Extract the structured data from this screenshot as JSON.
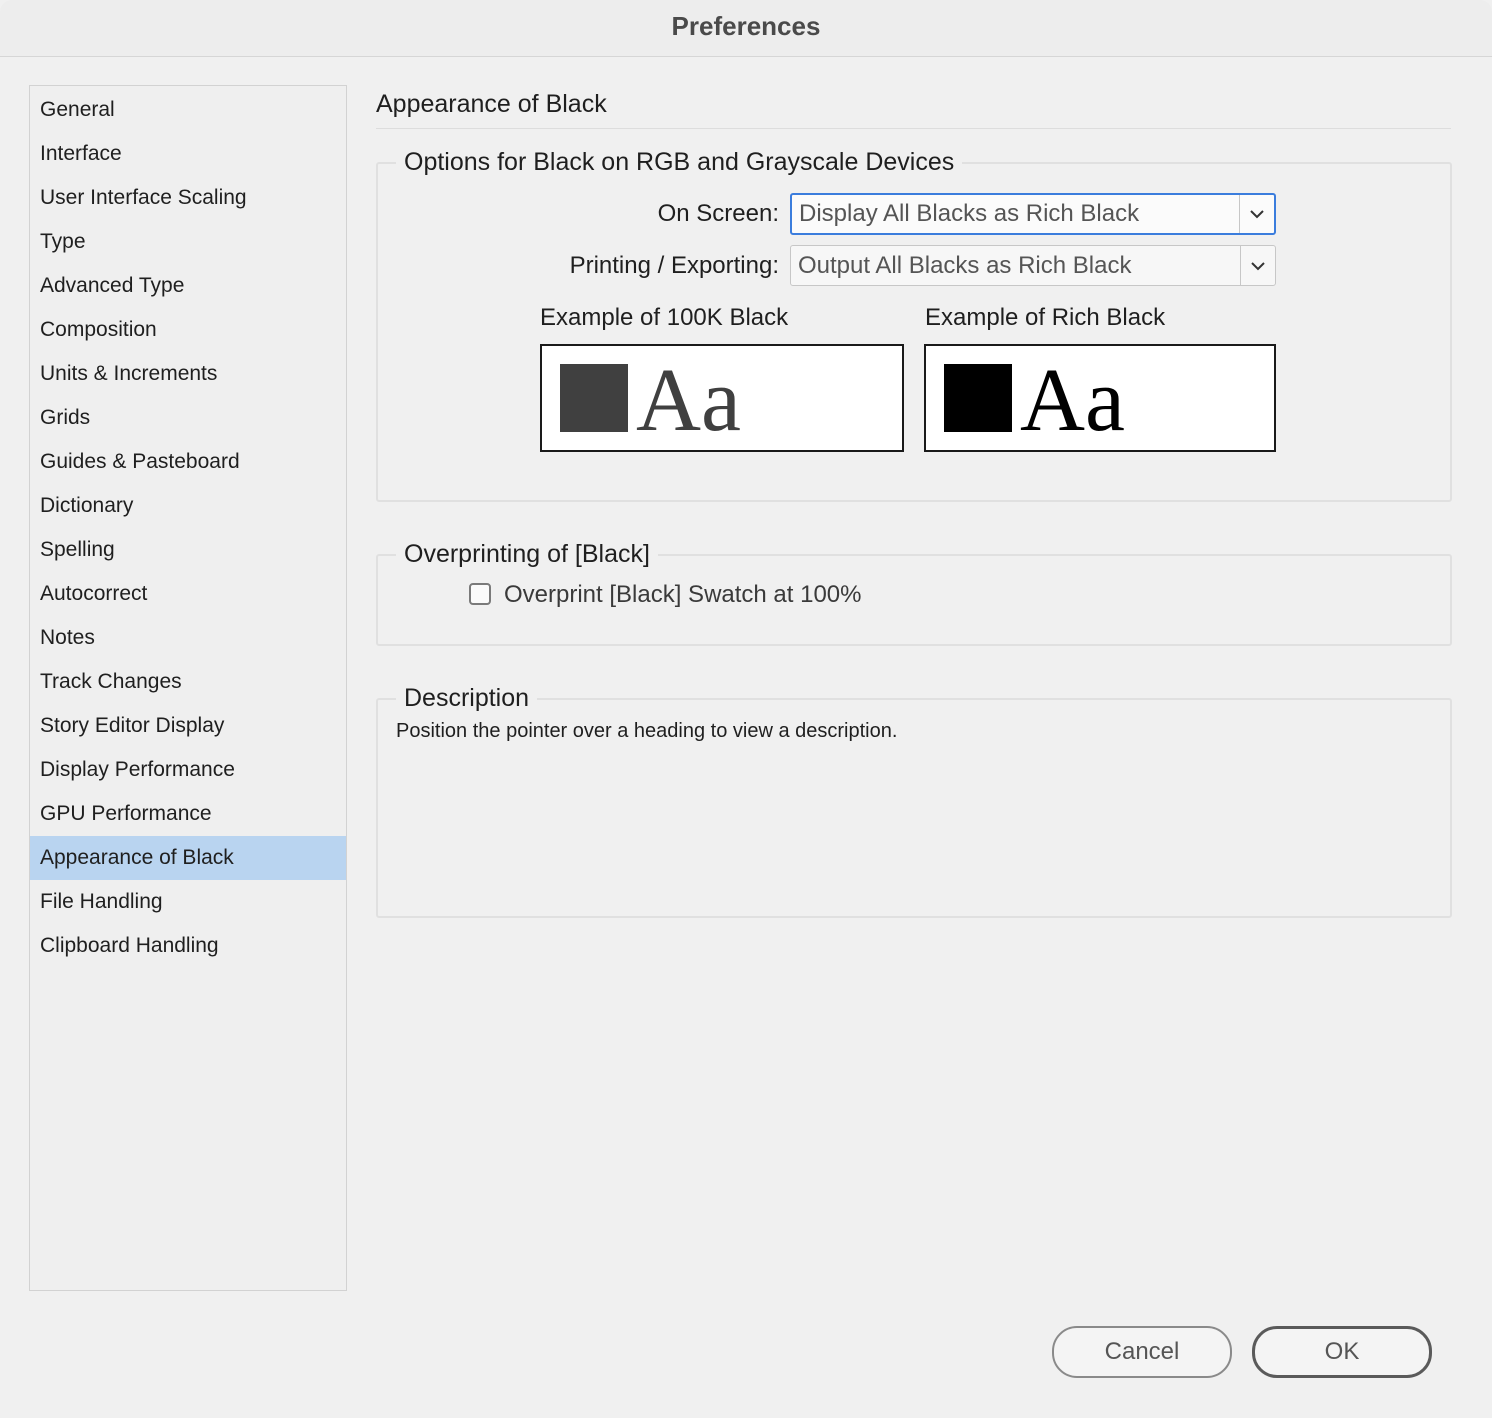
{
  "window": {
    "title": "Preferences"
  },
  "sidebar": {
    "items": [
      {
        "label": "General"
      },
      {
        "label": "Interface"
      },
      {
        "label": "User Interface Scaling"
      },
      {
        "label": "Type"
      },
      {
        "label": "Advanced Type"
      },
      {
        "label": "Composition"
      },
      {
        "label": "Units & Increments"
      },
      {
        "label": "Grids"
      },
      {
        "label": "Guides & Pasteboard"
      },
      {
        "label": "Dictionary"
      },
      {
        "label": "Spelling"
      },
      {
        "label": "Autocorrect"
      },
      {
        "label": "Notes"
      },
      {
        "label": "Track Changes"
      },
      {
        "label": "Story Editor Display"
      },
      {
        "label": "Display Performance"
      },
      {
        "label": "GPU Performance"
      },
      {
        "label": "Appearance of Black",
        "selected": true
      },
      {
        "label": "File Handling"
      },
      {
        "label": "Clipboard Handling"
      }
    ]
  },
  "panel": {
    "heading": "Appearance of Black",
    "options_group": {
      "legend": "Options for Black on RGB and Grayscale Devices",
      "on_screen_label": "On Screen:",
      "on_screen_value": "Display All Blacks as Rich Black",
      "printing_label": "Printing / Exporting:",
      "printing_value": "Output All Blacks as Rich Black",
      "example_100k_label": "Example of 100K Black",
      "example_rich_label": "Example of Rich Black",
      "sample_text": "Aa",
      "color_100k": "#404040",
      "color_rich": "#000000"
    },
    "overprint_group": {
      "legend": "Overprinting of [Black]",
      "checkbox_label": "Overprint [Black] Swatch at 100%",
      "checked": false
    },
    "description_group": {
      "legend": "Description",
      "text": "Position the pointer over a heading to view a description."
    }
  },
  "buttons": {
    "cancel": "Cancel",
    "ok": "OK"
  },
  "colors": {
    "selection": "#b9d4f0",
    "focus": "#3b7ddd"
  }
}
